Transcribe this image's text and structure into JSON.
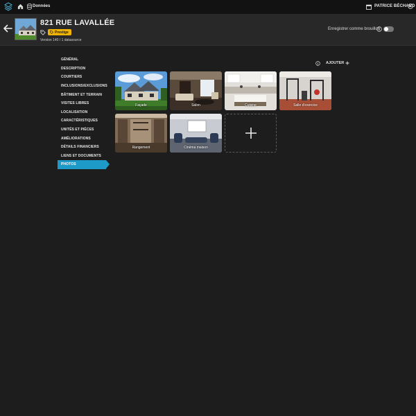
{
  "topbar": {
    "breadcrumb": "Données",
    "user_name": "PATRICE BÉCHARD"
  },
  "header": {
    "title": "821 RUE LAVALLÉE",
    "badge": "Prestige",
    "version": "Version 140 / 1 datasource",
    "draft_label": "Enregistrer comme brouillon",
    "draft_toggle_on": false
  },
  "sidebar": {
    "items": [
      {
        "label": "GÉNÉRAL"
      },
      {
        "label": "DESCRIPTION"
      },
      {
        "label": "COURTIERS"
      },
      {
        "label": "INCLUSIONS/EXCLUSIONS"
      },
      {
        "label": "BÂTIMENT ET TERRAIN"
      },
      {
        "label": "VISITES LIBRES"
      },
      {
        "label": "LOCALISATION"
      },
      {
        "label": "CARACTÉRISTIQUES"
      },
      {
        "label": "UNITÉS ET PIÈCES"
      },
      {
        "label": "AMÉLIORATIONS"
      },
      {
        "label": "DÉTAILS FINANCIERS"
      },
      {
        "label": "LIENS ET DOCUMENTS"
      },
      {
        "label": "PHOTOS"
      }
    ],
    "active_index": 12
  },
  "main": {
    "add_label": "AJOUTER",
    "photos": [
      {
        "label": "Façade",
        "icon": "house-photo"
      },
      {
        "label": "Salon",
        "icon": "living-room-photo"
      },
      {
        "label": "Cuisine",
        "icon": "kitchen-photo"
      },
      {
        "label": "Salle d'exercice",
        "icon": "gym-photo"
      },
      {
        "label": "Rangement",
        "icon": "closet-photo"
      },
      {
        "label": "Cinéma maison",
        "icon": "home-theater-photo"
      }
    ]
  },
  "colors": {
    "accent": "#1e9ac9",
    "badge": "#f0b400",
    "background": "#1d1d1d"
  }
}
